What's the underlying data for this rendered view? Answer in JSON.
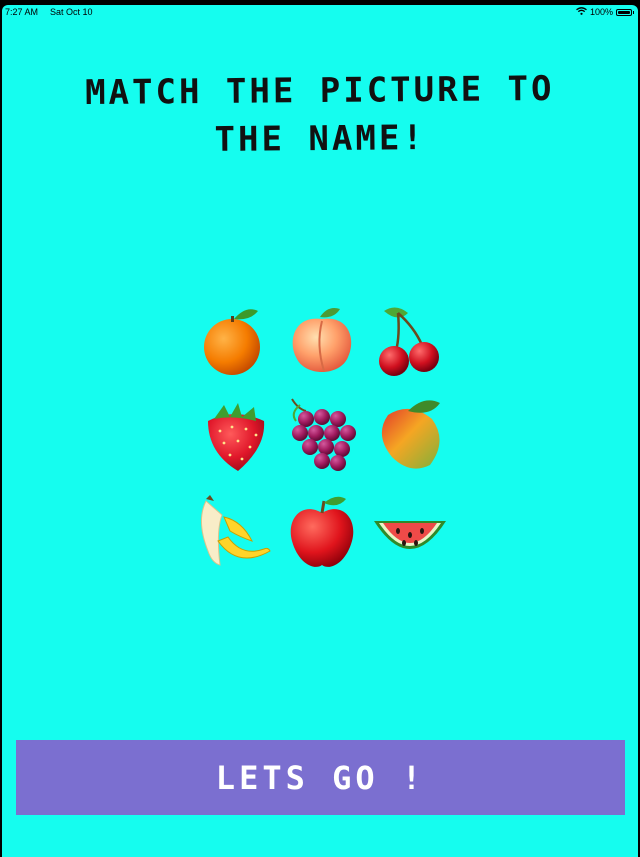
{
  "status_bar": {
    "time": "7:27 AM",
    "date": "Sat Oct 10",
    "battery": "100%",
    "battery_level": 1.0,
    "icons": [
      "wifi-icon",
      "battery-icon"
    ]
  },
  "screen": {
    "title_line1": "MATCH THE PICTURE TO",
    "title_line2": "THE NAME!",
    "background_color": "#15fdef"
  },
  "fruits": [
    {
      "icon": "orange-icon"
    },
    {
      "icon": "peach-icon"
    },
    {
      "icon": "cherries-icon"
    },
    {
      "icon": "strawberry-icon"
    },
    {
      "icon": "grapes-icon"
    },
    {
      "icon": "mango-icon"
    },
    {
      "icon": "banana-icon"
    },
    {
      "icon": "apple-icon"
    },
    {
      "icon": "watermelon-icon"
    }
  ],
  "go_button": {
    "label": "LETS GO !",
    "color": "#7b6fd0"
  }
}
